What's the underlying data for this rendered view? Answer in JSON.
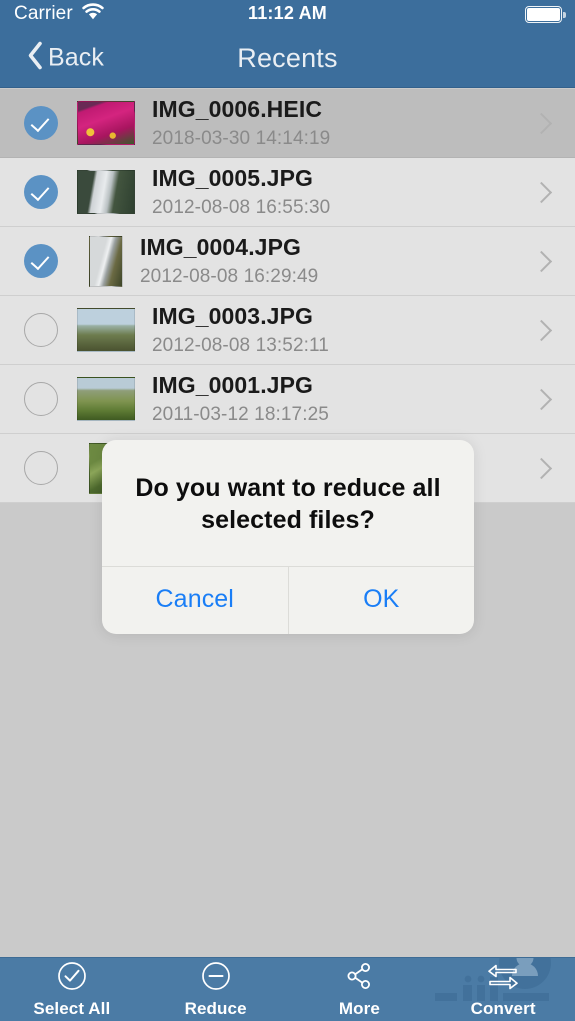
{
  "status_bar": {
    "carrier": "Carrier",
    "wifi_icon": "wifi-icon",
    "time": "11:12 AM",
    "battery_icon": "battery-full-icon"
  },
  "nav_bar": {
    "back_label": "Back",
    "back_icon": "chevron-left-icon",
    "title": "Recents"
  },
  "colors": {
    "nav_blue": "#3c6e9c",
    "toolbar_blue": "#4b7ba5",
    "checkbox_blue": "#5b92c4",
    "alert_action_blue": "#1a7ef6",
    "row_background": "#e3e3e3",
    "row_highlight": "#bdbdbd",
    "page_background": "#cacaca"
  },
  "list": {
    "rows": [
      {
        "name": "IMG_0006.HEIC",
        "date": "2018-03-30 14:14:19",
        "selected": true,
        "highlighted": true,
        "thumb_orientation": "landscape",
        "thumb_alt": "pink-flowers-thumbnail"
      },
      {
        "name": "IMG_0005.JPG",
        "date": "2012-08-08 16:55:30",
        "selected": true,
        "highlighted": false,
        "thumb_orientation": "landscape",
        "thumb_alt": "waterfall-thumbnail"
      },
      {
        "name": "IMG_0004.JPG",
        "date": "2012-08-08 16:29:49",
        "selected": true,
        "highlighted": false,
        "thumb_orientation": "portrait",
        "thumb_alt": "cascade-thumbnail"
      },
      {
        "name": "IMG_0003.JPG",
        "date": "2012-08-08 13:52:11",
        "selected": false,
        "highlighted": false,
        "thumb_orientation": "landscape",
        "thumb_alt": "coastal-cliff-thumbnail"
      },
      {
        "name": "IMG_0001.JPG",
        "date": "2011-03-12 18:17:25",
        "selected": false,
        "highlighted": false,
        "thumb_orientation": "landscape",
        "thumb_alt": "hillside-meadow-thumbnail"
      },
      {
        "name": "",
        "date": "",
        "selected": false,
        "highlighted": false,
        "thumb_orientation": "portrait",
        "thumb_alt": "green-foliage-thumbnail"
      }
    ],
    "disclosure_icon": "chevron-right-icon"
  },
  "alert": {
    "title": "Do you want to reduce all selected files?",
    "cancel_label": "Cancel",
    "ok_label": "OK"
  },
  "toolbar": {
    "items": [
      {
        "label": "Select All",
        "icon": "check-circle-icon"
      },
      {
        "label": "Reduce",
        "icon": "minus-circle-icon"
      },
      {
        "label": "More",
        "icon": "share-nodes-icon"
      },
      {
        "label": "Convert",
        "icon": "convert-arrows-icon"
      }
    ],
    "watermark_icon": "farsroid-watermark"
  }
}
